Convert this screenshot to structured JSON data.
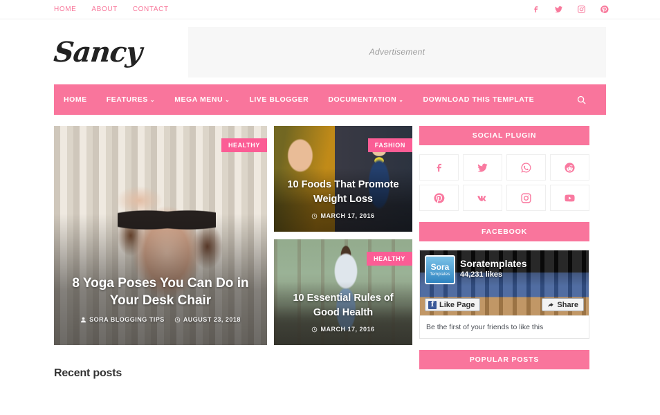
{
  "topbar": {
    "nav": [
      {
        "label": "HOME"
      },
      {
        "label": "ABOUT"
      },
      {
        "label": "CONTACT"
      }
    ],
    "social": [
      {
        "name": "facebook-icon"
      },
      {
        "name": "twitter-icon"
      },
      {
        "name": "instagram-icon"
      },
      {
        "name": "pinterest-icon"
      }
    ]
  },
  "header": {
    "logo": "Sancy",
    "ad_text": "Advertisement"
  },
  "mainnav": {
    "items": [
      {
        "label": "HOME",
        "caret": ""
      },
      {
        "label": "FEATURES",
        "caret": "⌄"
      },
      {
        "label": "MEGA MENU",
        "caret": "⌄"
      },
      {
        "label": "LIVE BLOGGER",
        "caret": ""
      },
      {
        "label": "DOCUMENTATION",
        "caret": "⌄"
      },
      {
        "label": "DOWNLOAD THIS TEMPLATE",
        "caret": ""
      }
    ],
    "search_label": "Search"
  },
  "featured": {
    "big": {
      "badge": "HEALTHY",
      "title": "8 Yoga Poses You Can Do in Your Desk Chair",
      "author": "SORA BLOGGING TIPS",
      "date": "AUGUST 23, 2018"
    },
    "small": [
      {
        "badge": "FASHION",
        "title": "10 Foods That Promote Weight Loss",
        "date": "MARCH 17, 2016"
      },
      {
        "badge": "HEALTHY",
        "title": "10 Essential Rules of Good Health",
        "date": "MARCH 17, 2016"
      }
    ]
  },
  "recent": {
    "heading": "Recent posts"
  },
  "sidebar": {
    "social_plugin": {
      "title": "SOCIAL PLUGIN",
      "icons": [
        {
          "name": "facebook-icon"
        },
        {
          "name": "twitter-icon"
        },
        {
          "name": "whatsapp-icon"
        },
        {
          "name": "reddit-icon"
        },
        {
          "name": "pinterest-icon"
        },
        {
          "name": "vk-icon"
        },
        {
          "name": "instagram-icon"
        },
        {
          "name": "youtube-icon"
        }
      ]
    },
    "facebook": {
      "title": "FACEBOOK",
      "page_name": "Soratemplates",
      "likes": "44,231 likes",
      "avatar_line1": "Sora",
      "avatar_line2": "Templates",
      "like_button": "Like Page",
      "share_button": "Share",
      "footer_text": "Be the first of your friends to like this"
    },
    "popular_posts": {
      "title": "POPULAR POSTS"
    }
  },
  "colors": {
    "brand_pink": "#f9759c",
    "badge_pink": "#fb5d95",
    "icon_pink": "#f97aa0",
    "ad_bg": "#f7f7f7"
  }
}
